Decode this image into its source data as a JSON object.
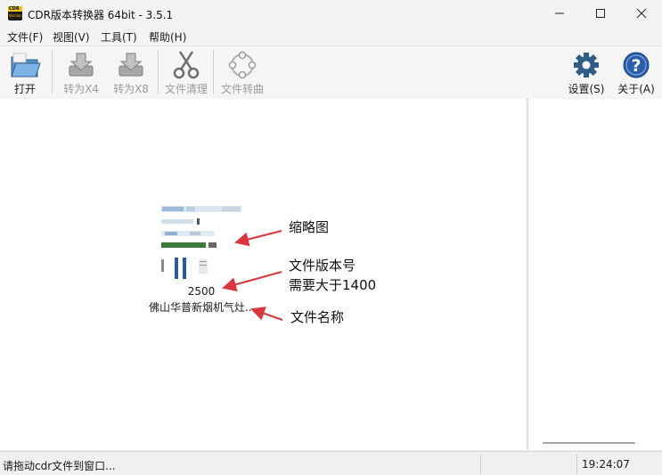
{
  "window": {
    "title": "CDR版本转换器 64bit - 3.5.1",
    "app_icon_text_top": "CDR",
    "app_icon_text_bottom": "Version"
  },
  "menu": [
    {
      "label": "文件(F)"
    },
    {
      "label": "视图(V)"
    },
    {
      "label": "工具(T)"
    },
    {
      "label": "帮助(H)"
    }
  ],
  "toolbar": {
    "open": {
      "label": "打开",
      "icon": "folder-open-icon",
      "enabled": true
    },
    "convert_x4": {
      "label": "转为X4",
      "icon": "convert-down-icon",
      "enabled": false
    },
    "convert_x8": {
      "label": "转为X8",
      "icon": "convert-down-icon",
      "enabled": false
    },
    "clean": {
      "label": "文件清理",
      "icon": "scissors-icon",
      "enabled": false
    },
    "curve": {
      "label": "文件转曲",
      "icon": "curve-nodes-icon",
      "enabled": false
    },
    "settings": {
      "label": "设置(S)",
      "icon": "gear-icon",
      "enabled": true
    },
    "about": {
      "label": "关于(A)",
      "icon": "help-icon",
      "enabled": true
    }
  },
  "file_card": {
    "version": "2500",
    "name": "佛山华普新烟机气灶..."
  },
  "annotations": {
    "thumbnail": "缩略图",
    "version_line1": "文件版本号",
    "version_line2": "需要大于1400",
    "file_name": "文件名称"
  },
  "status": {
    "message": "请拖动cdr文件到窗口...",
    "time": "19:24:07"
  },
  "colors": {
    "arrow": "#d9363e",
    "settings_gear": "#2e5d86",
    "help_circle": "#2a5ea8"
  }
}
